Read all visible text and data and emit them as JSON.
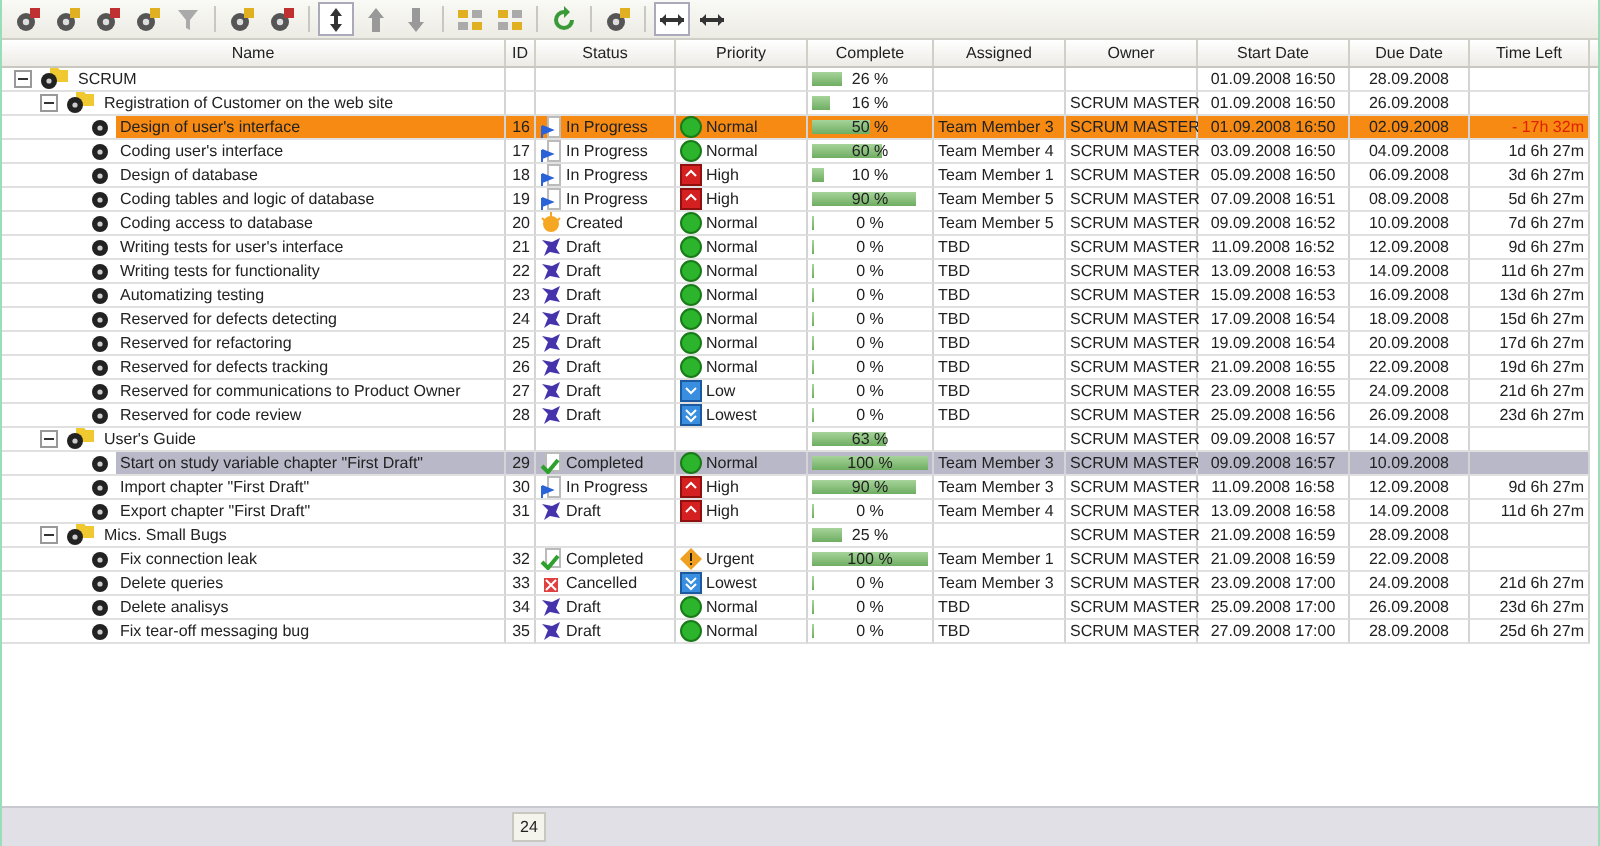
{
  "columns": [
    "Name",
    "ID",
    "Status",
    "Priority",
    "Complete",
    "Assigned",
    "Owner",
    "Start Date",
    "Due Date",
    "Time Left"
  ],
  "tree": [
    {
      "kind": "group",
      "name": "SCRUM",
      "expanded": true,
      "selected": false,
      "focused": false,
      "complete": "26 %",
      "level": 0.26,
      "start": "01.09.2008 16:50",
      "due": "28.09.2008",
      "children": [
        {
          "kind": "group",
          "name": "Registration of Customer on the web site",
          "expanded": true,
          "selected": false,
          "focused": false,
          "complete": "16 %",
          "level": 0.16,
          "owner": "SCRUM MASTER",
          "start": "01.09.2008 16:50",
          "due": "26.09.2008",
          "children": [
            {
              "kind": "task",
              "name": "Design of user's interface",
              "id": "16",
              "status": {
                "kind": "progress",
                "label": "In Progress"
              },
              "priority": {
                "kind": "normal",
                "label": "Normal"
              },
              "complete": "50 %",
              "level": 0.5,
              "assigned": "Team Member 3",
              "owner": "SCRUM MASTER",
              "start": "01.09.2008 16:50",
              "due": "02.09.2008",
              "time_left": "- 17h 32m",
              "overdue": true,
              "selected": true,
              "focused": false
            },
            {
              "kind": "task",
              "name": "Coding user's interface",
              "id": "17",
              "status": {
                "kind": "progress",
                "label": "In Progress"
              },
              "priority": {
                "kind": "normal",
                "label": "Normal"
              },
              "complete": "60 %",
              "level": 0.6,
              "assigned": "Team Member 4",
              "owner": "SCRUM MASTER",
              "start": "03.09.2008 16:50",
              "due": "04.09.2008",
              "time_left": "1d 6h 27m",
              "overdue": false,
              "selected": false,
              "focused": false
            },
            {
              "kind": "task",
              "name": "Design of database",
              "id": "18",
              "status": {
                "kind": "progress",
                "label": "In Progress"
              },
              "priority": {
                "kind": "high",
                "label": "High"
              },
              "complete": "10 %",
              "level": 0.1,
              "assigned": "Team Member 1",
              "owner": "SCRUM MASTER",
              "start": "05.09.2008 16:50",
              "due": "06.09.2008",
              "time_left": "3d 6h 27m",
              "overdue": false,
              "selected": false,
              "focused": false
            },
            {
              "kind": "task",
              "name": "Coding tables and logic of database",
              "id": "19",
              "status": {
                "kind": "progress",
                "label": "In Progress"
              },
              "priority": {
                "kind": "high",
                "label": "High"
              },
              "complete": "90 %",
              "level": 0.9,
              "assigned": "Team Member 5",
              "owner": "SCRUM MASTER",
              "start": "07.09.2008 16:51",
              "due": "08.09.2008",
              "time_left": "5d 6h 27m",
              "overdue": false,
              "selected": false,
              "focused": false
            },
            {
              "kind": "task",
              "name": "Coding access to database",
              "id": "20",
              "status": {
                "kind": "created",
                "label": "Created"
              },
              "priority": {
                "kind": "normal",
                "label": "Normal"
              },
              "complete": "0 %",
              "level": 0,
              "assigned": "Team Member 5",
              "owner": "SCRUM MASTER",
              "start": "09.09.2008 16:52",
              "due": "10.09.2008",
              "time_left": "7d 6h 27m",
              "overdue": false,
              "selected": false,
              "focused": false
            },
            {
              "kind": "task",
              "name": "Writing tests for user's interface",
              "id": "21",
              "status": {
                "kind": "draft",
                "label": "Draft"
              },
              "priority": {
                "kind": "normal",
                "label": "Normal"
              },
              "complete": "0 %",
              "level": 0,
              "assigned": "TBD",
              "owner": "SCRUM MASTER",
              "start": "11.09.2008 16:52",
              "due": "12.09.2008",
              "time_left": "9d 6h 27m",
              "overdue": false,
              "selected": false,
              "focused": false
            },
            {
              "kind": "task",
              "name": "Writing tests for functionality",
              "id": "22",
              "status": {
                "kind": "draft",
                "label": "Draft"
              },
              "priority": {
                "kind": "normal",
                "label": "Normal"
              },
              "complete": "0 %",
              "level": 0,
              "assigned": "TBD",
              "owner": "SCRUM MASTER",
              "start": "13.09.2008 16:53",
              "due": "14.09.2008",
              "time_left": "11d 6h 27m",
              "overdue": false,
              "selected": false,
              "focused": false
            },
            {
              "kind": "task",
              "name": "Automatizing testing",
              "id": "23",
              "status": {
                "kind": "draft",
                "label": "Draft"
              },
              "priority": {
                "kind": "normal",
                "label": "Normal"
              },
              "complete": "0 %",
              "level": 0,
              "assigned": "TBD",
              "owner": "SCRUM MASTER",
              "start": "15.09.2008 16:53",
              "due": "16.09.2008",
              "time_left": "13d 6h 27m",
              "overdue": false,
              "selected": false,
              "focused": false
            },
            {
              "kind": "task",
              "name": "Reserved for defects detecting",
              "id": "24",
              "status": {
                "kind": "draft",
                "label": "Draft"
              },
              "priority": {
                "kind": "normal",
                "label": "Normal"
              },
              "complete": "0 %",
              "level": 0,
              "assigned": "TBD",
              "owner": "SCRUM MASTER",
              "start": "17.09.2008 16:54",
              "due": "18.09.2008",
              "time_left": "15d 6h 27m",
              "overdue": false,
              "selected": false,
              "focused": false
            },
            {
              "kind": "task",
              "name": "Reserved for refactoring",
              "id": "25",
              "status": {
                "kind": "draft",
                "label": "Draft"
              },
              "priority": {
                "kind": "normal",
                "label": "Normal"
              },
              "complete": "0 %",
              "level": 0,
              "assigned": "TBD",
              "owner": "SCRUM MASTER",
              "start": "19.09.2008 16:54",
              "due": "20.09.2008",
              "time_left": "17d 6h 27m",
              "overdue": false,
              "selected": false,
              "focused": false
            },
            {
              "kind": "task",
              "name": "Reserved for defects tracking",
              "id": "26",
              "status": {
                "kind": "draft",
                "label": "Draft"
              },
              "priority": {
                "kind": "normal",
                "label": "Normal"
              },
              "complete": "0 %",
              "level": 0,
              "assigned": "TBD",
              "owner": "SCRUM MASTER",
              "start": "21.09.2008 16:55",
              "due": "22.09.2008",
              "time_left": "19d 6h 27m",
              "overdue": false,
              "selected": false,
              "focused": false
            },
            {
              "kind": "task",
              "name": "Reserved for communications to Product Owner",
              "id": "27",
              "status": {
                "kind": "draft",
                "label": "Draft"
              },
              "priority": {
                "kind": "low",
                "label": "Low"
              },
              "complete": "0 %",
              "level": 0,
              "assigned": "TBD",
              "owner": "SCRUM MASTER",
              "start": "23.09.2008 16:55",
              "due": "24.09.2008",
              "time_left": "21d 6h 27m",
              "overdue": false,
              "selected": false,
              "focused": false
            },
            {
              "kind": "task",
              "name": "Reserved for code review",
              "id": "28",
              "status": {
                "kind": "draft",
                "label": "Draft"
              },
              "priority": {
                "kind": "lowest",
                "label": "Lowest"
              },
              "complete": "0 %",
              "level": 0,
              "assigned": "TBD",
              "owner": "SCRUM MASTER",
              "start": "25.09.2008 16:56",
              "due": "26.09.2008",
              "time_left": "23d 6h 27m",
              "overdue": false,
              "selected": false,
              "focused": false
            }
          ]
        },
        {
          "kind": "group",
          "name": "User's Guide",
          "expanded": true,
          "selected": false,
          "focused": false,
          "complete": "63 %",
          "level": 0.63,
          "owner": "SCRUM MASTER",
          "start": "09.09.2008 16:57",
          "due": "14.09.2008",
          "children": [
            {
              "kind": "task",
              "name": "Start on study variable chapter \"First Draft\"",
              "id": "29",
              "status": {
                "kind": "completed",
                "label": "Completed"
              },
              "priority": {
                "kind": "normal",
                "label": "Normal"
              },
              "complete": "100 %",
              "level": 1,
              "assigned": "Team Member 3",
              "owner": "SCRUM MASTER",
              "start": "09.09.2008 16:57",
              "due": "10.09.2008",
              "selected": false,
              "focused": true
            },
            {
              "kind": "task",
              "name": "Import chapter \"First Draft\"",
              "id": "30",
              "status": {
                "kind": "progress",
                "label": "In Progress"
              },
              "priority": {
                "kind": "high",
                "label": "High"
              },
              "complete": "90 %",
              "level": 0.9,
              "assigned": "Team Member 3",
              "owner": "SCRUM MASTER",
              "start": "11.09.2008 16:58",
              "due": "12.09.2008",
              "time_left": "9d 6h 27m",
              "overdue": false,
              "selected": false,
              "focused": false
            },
            {
              "kind": "task",
              "name": "Export chapter \"First Draft\"",
              "id": "31",
              "status": {
                "kind": "draft",
                "label": "Draft"
              },
              "priority": {
                "kind": "high",
                "label": "High"
              },
              "complete": "0 %",
              "level": 0,
              "assigned": "Team Member 4",
              "owner": "SCRUM MASTER",
              "start": "13.09.2008 16:58",
              "due": "14.09.2008",
              "time_left": "11d 6h 27m",
              "overdue": false,
              "selected": false,
              "focused": false
            }
          ]
        },
        {
          "kind": "group",
          "name": "Mics. Small Bugs",
          "expanded": true,
          "selected": false,
          "focused": false,
          "complete": "25 %",
          "level": 0.25,
          "owner": "SCRUM MASTER",
          "start": "21.09.2008 16:59",
          "due": "28.09.2008",
          "children": [
            {
              "kind": "task",
              "name": "Fix connection leak",
              "id": "32",
              "status": {
                "kind": "completed",
                "label": "Completed"
              },
              "priority": {
                "kind": "urgent",
                "label": "Urgent"
              },
              "complete": "100 %",
              "level": 1,
              "assigned": "Team Member 1",
              "owner": "SCRUM MASTER",
              "start": "21.09.2008 16:59",
              "due": "22.09.2008",
              "selected": false,
              "focused": false
            },
            {
              "kind": "task",
              "name": "Delete queries",
              "id": "33",
              "status": {
                "kind": "cancelled",
                "label": "Cancelled"
              },
              "priority": {
                "kind": "lowest",
                "label": "Lowest"
              },
              "complete": "0 %",
              "level": 0,
              "assigned": "Team Member 3",
              "owner": "SCRUM MASTER",
              "start": "23.09.2008 17:00",
              "due": "24.09.2008",
              "time_left": "21d 6h 27m",
              "overdue": false,
              "selected": false,
              "focused": false
            },
            {
              "kind": "task",
              "name": "Delete analisys",
              "id": "34",
              "status": {
                "kind": "draft",
                "label": "Draft"
              },
              "priority": {
                "kind": "normal",
                "label": "Normal"
              },
              "complete": "0 %",
              "level": 0,
              "assigned": "TBD",
              "owner": "SCRUM MASTER",
              "start": "25.09.2008 17:00",
              "due": "26.09.2008",
              "time_left": "23d 6h 27m",
              "overdue": false,
              "selected": false,
              "focused": false
            },
            {
              "kind": "task",
              "name": "Fix tear-off messaging bug",
              "id": "35",
              "status": {
                "kind": "draft",
                "label": "Draft"
              },
              "priority": {
                "kind": "normal",
                "label": "Normal"
              },
              "complete": "0 %",
              "level": 0,
              "assigned": "TBD",
              "owner": "SCRUM MASTER",
              "start": "27.09.2008 17:00",
              "due": "28.09.2008",
              "time_left": "25d 6h 27m",
              "overdue": false,
              "selected": false,
              "focused": false
            }
          ]
        }
      ]
    }
  ],
  "status_bar": {
    "count": "24"
  }
}
